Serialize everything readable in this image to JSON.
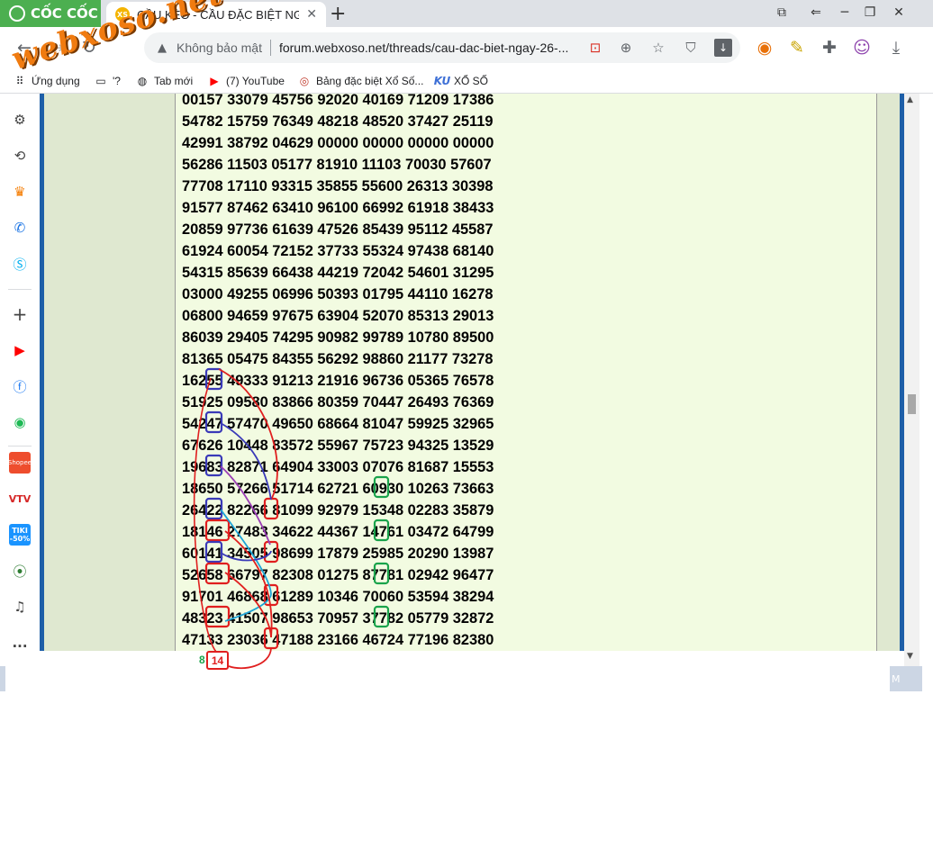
{
  "browser": {
    "brand": "CỐC CỐC",
    "tab": {
      "favicon": "XS",
      "title": "CẦU KÈO - CẦU ĐẶC BIỆT NGÀY",
      "close": "✕"
    },
    "new_tab": "+",
    "window_controls": [
      "screenshot-icon",
      "back-arrow-icon",
      "minimize-icon",
      "restore-icon",
      "close-icon"
    ]
  },
  "toolbar": {
    "back": "←",
    "forward": "→",
    "security_label": "Không bảo mật",
    "url": "forum.webxoso.net/threads/cau-dac-biet-ngay-26-..."
  },
  "bookmarks": [
    {
      "label": "Ứng dụng",
      "icon": "apps-icon"
    },
    {
      "label": "'?",
      "icon": "folder-icon"
    },
    {
      "label": "Tab mới",
      "icon": "globe-icon"
    },
    {
      "label": "(7) YouTube",
      "icon": "youtube-icon"
    },
    {
      "label": "Bảng đặc biệt Xổ Số...",
      "icon": "xoso-icon"
    },
    {
      "label": "XỔ SỐ",
      "icon": "ku-icon"
    }
  ],
  "sidebar": {
    "tiki_label": "TIKI -50%",
    "shopee_label": "Shopee",
    "more": "..."
  },
  "rows": [
    "00157 33079 45756 92020 40169 71209 17386",
    "54782 15759 76349 48218 48520 37427 25119",
    "42991 38792 04629 00000 00000 00000 00000",
    "56286 11503 05177 81910 11103 70030 57607",
    "77708 17110 93315 35855 55600 26313 30398",
    "91577 87462 63410 96100 66992 61918 38433",
    "20859 97736 61639 47526 85439 95112 45587",
    "61924 60054 72152 37733 55324 97438 68140",
    "54315 85639 66438 44219 72042 54601 31295",
    "03000 49255 06996 50393 01795 44110 16278",
    "06800 94659 97675 63904 52070 85313 29013",
    "86039 29405 74295 90982 99789 10780 89500",
    "81365 05475 84355 56292 98860 21177 73278",
    "16255 49333 91213 21916 96736 05365 76578",
    "51925 09580 83866 80359 70447 26493 76369",
    "54247 57470 49650 68664 81047 59925 32965",
    "67626 10448 83572 55967 75723 94325 13529",
    "19683 82871 64904 33003 07076 81687 15553",
    "18650 57266 51714 62721 60930 10263 73663",
    "26422 82266 81099 92979 15348 02283 35879",
    "18146 27483 34622 44367 14761 03472 64799",
    "60141 34505 98699 17879 25985 20290 13987",
    "52658 66797 82308 01275 87781 02942 96477",
    "91701 46868 61289 10346 70060 53594 38294",
    "48323 41507 98653 70957 37782 05779 32872",
    "47133 23036 47188 23166 46724 77196 82380"
  ],
  "result": {
    "green": "8",
    "red": "14"
  },
  "watermark": "webxoso.net",
  "colors": {
    "panel": "#f2fbe1",
    "side_green": "#dfe8d0",
    "frame_blue": "#1e5fa8",
    "mark_red": "#e01f1f",
    "mark_blue": "#3a3ab8",
    "mark_green": "#19a34b",
    "mark_cyan": "#1ca3d6",
    "mark_purple": "#9b3fb5"
  }
}
